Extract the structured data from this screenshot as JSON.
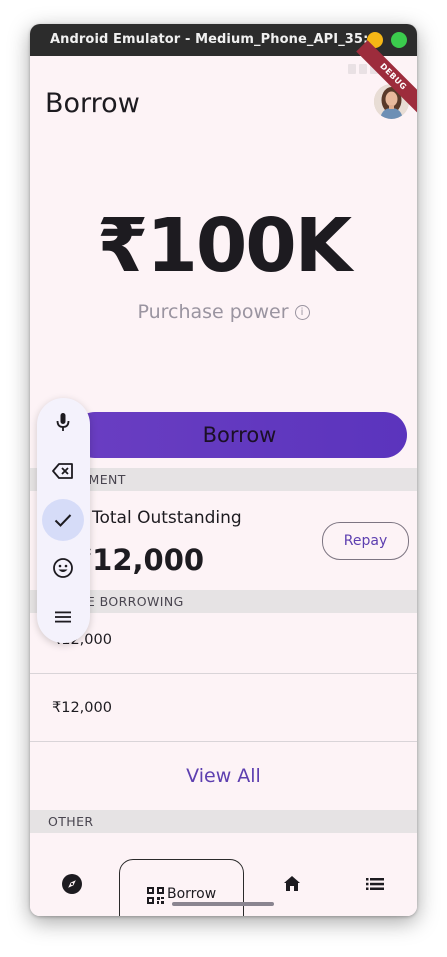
{
  "window": {
    "title": "Android Emulator - Medium_Phone_API_35:..."
  },
  "debug_banner": "DEBUG",
  "header": {
    "title": "Borrow"
  },
  "purchase": {
    "amount": "₹100K",
    "label": "Purchase power",
    "info_glyph": "ⓘ"
  },
  "borrow_button": {
    "label": "Borrow"
  },
  "sections": {
    "repayment": "REPAYMENT",
    "active_borrowing": "ACTIVE BORROWING",
    "other": "OTHER"
  },
  "outstanding": {
    "label": "Total Outstanding",
    "amount": "₹12,000",
    "repay_label": "Repay"
  },
  "active_items": [
    {
      "amount": "₹12,000"
    },
    {
      "amount": "₹12,000"
    }
  ],
  "view_all_label": "View All",
  "bottom_nav": {
    "items": [
      {
        "icon": "compass-icon"
      },
      {
        "icon": "qr-code-icon",
        "label": "Borrow"
      },
      {
        "icon": "home-icon"
      },
      {
        "icon": "list-icon"
      }
    ]
  },
  "ime_toolbar": {
    "icons": [
      "mic-icon",
      "backspace-icon",
      "check-icon",
      "emoji-icon",
      "menu-icon"
    ]
  },
  "colors": {
    "accent": "#5d3fb0",
    "button_gradient_start": "#6a3ec2",
    "button_gradient_end": "#5b34bd",
    "background": "#fdf3f6",
    "section_bar": "#e6e3e4",
    "titlebar": "#2c2c2c"
  }
}
